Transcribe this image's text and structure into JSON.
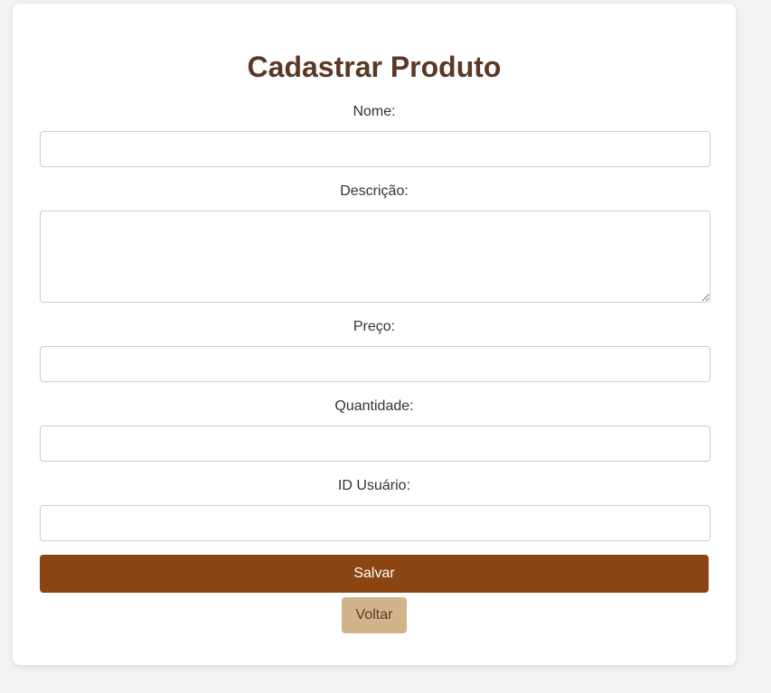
{
  "form": {
    "title": "Cadastrar Produto",
    "fields": {
      "nome": {
        "label": "Nome:",
        "value": "",
        "placeholder": ""
      },
      "descricao": {
        "label": "Descrição:",
        "value": "",
        "placeholder": ""
      },
      "preco": {
        "label": "Preço:",
        "value": "",
        "placeholder": ""
      },
      "quantidade": {
        "label": "Quantidade:",
        "value": "",
        "placeholder": ""
      },
      "id_usuario": {
        "label": "ID Usuário:",
        "value": "",
        "placeholder": ""
      }
    },
    "save_label": "Salvar",
    "back_label": "Voltar"
  },
  "colors": {
    "title": "#5a3825",
    "save_button": "#8b4513",
    "back_button": "#d2b48c",
    "background": "#f3f3f3"
  }
}
